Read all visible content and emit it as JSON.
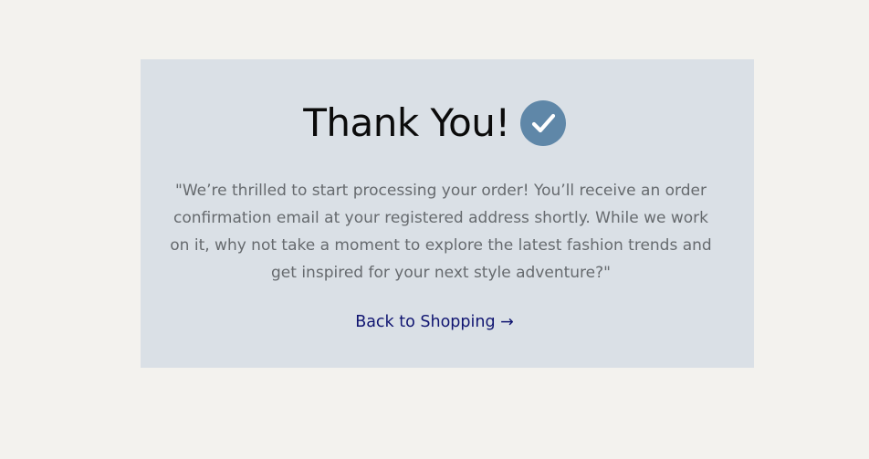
{
  "confirmation": {
    "title": "Thank You!",
    "check_icon": "check-circle-icon",
    "message": "\"We’re thrilled to start processing your order! You’ll receive an order confirmation email at your registered address shortly. While we work on it, why not take a moment to explore the latest fashion trends and get inspired for your next style adventure?\"",
    "back_link_label": "Back to Shopping →"
  },
  "colors": {
    "page_background": "#f3f2ee",
    "card_background": "#dae0e6",
    "check_circle": "#5f87a8",
    "link": "#101571",
    "message_text": "#666a6e"
  }
}
